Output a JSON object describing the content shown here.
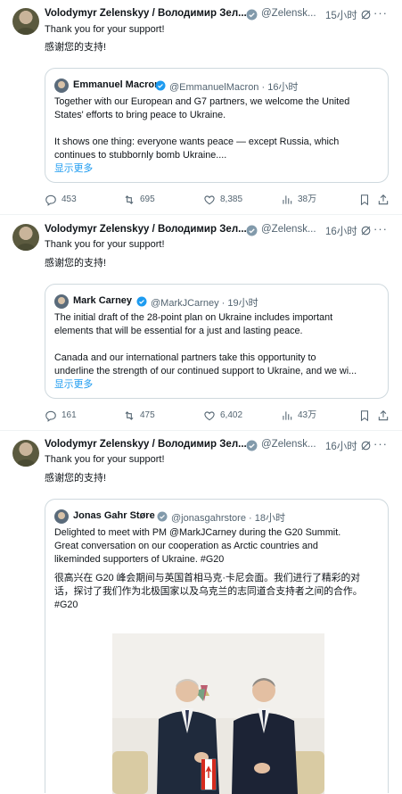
{
  "colors": {
    "accent": "#1d9bf0",
    "secondary_text": "#536471",
    "border": "#cfd9de"
  },
  "tweets": [
    {
      "name": "Volodymyr Zelenskyy / Володимир Зел...",
      "handle": "@Zelensk...",
      "time": "15小时",
      "text_en": "Thank you for your support!",
      "text_zh": "感谢您的支持!",
      "quote": {
        "name": "Emmanuel Macron",
        "handle": "@EmmanuelMacron · 16小时",
        "lines": [
          "Together with our European and G7 partners, we welcome the United",
          "States' efforts to bring peace to Ukraine.",
          "",
          "It shows one thing: everyone wants peace — except Russia, which",
          "continues to stubbornly bomb Ukraine...."
        ],
        "show_more": "显示更多"
      },
      "actions": {
        "replies": "453",
        "reposts": "695",
        "likes": "8,385",
        "views": "38万"
      }
    },
    {
      "name": "Volodymyr Zelenskyy / Володимир Зел...",
      "handle": "@Zelensk...",
      "time": "16小时",
      "text_en": "Thank you for your support!",
      "text_zh": "感谢您的支持!",
      "quote": {
        "name": "Mark Carney",
        "handle": "@MarkJCarney · 19小时",
        "lines": [
          "The initial draft of the 28-point plan on Ukraine includes important",
          "elements that will be essential for a just and lasting peace.",
          "",
          "Canada and our international partners take this opportunity to",
          "underline the strength of our continued support to Ukraine, and we wi..."
        ],
        "show_more": "显示更多"
      },
      "actions": {
        "replies": "161",
        "reposts": "475",
        "likes": "6,402",
        "views": "43万"
      }
    },
    {
      "name": "Volodymyr Zelenskyy / Володимир Зел...",
      "handle": "@Zelensk...",
      "time": "16小时",
      "text_en": "Thank you for your support!",
      "text_zh": "感谢您的支持!",
      "quote": {
        "name": "Jonas Gahr Støre",
        "handle": "@jonasgahrstore · 18小时",
        "lines": [
          "Delighted to meet with PM @MarkJCarney during the G20 Summit.",
          "Great conversation on our cooperation as Arctic countries and",
          "likeminded supporters of Ukraine. #G20",
          "",
          "很高兴在 G20 峰会期间与英国首相马克·卡尼会面。我们进行了精彩的对",
          "话，探讨了我们作为北极国家以及乌克兰的志同道合支持者之间的合作。",
          "#G20"
        ]
      }
    }
  ]
}
